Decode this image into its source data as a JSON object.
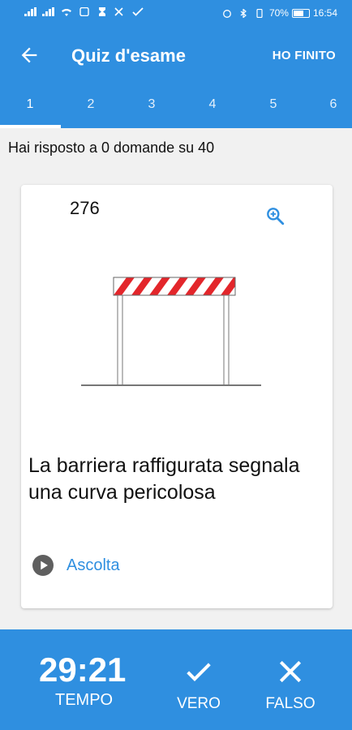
{
  "status_bar": {
    "battery": "70%",
    "time": "16:54"
  },
  "header": {
    "title": "Quiz d'esame",
    "done_label": "HO FINITO",
    "back_icon": "arrow-back-icon"
  },
  "tabs": [
    "1",
    "2",
    "3",
    "4",
    "5",
    "6"
  ],
  "selected_tab": "1",
  "progress_text": "Hai risposto a 0 domande su 40",
  "question": {
    "number": "276",
    "text": "La barriera raffigurata segnala una curva pericolosa",
    "listen_label": "Ascolta",
    "zoom_icon": "zoom-in-icon"
  },
  "footer": {
    "timer": "29:21",
    "timer_label": "TEMPO",
    "true_label": "VERO",
    "false_label": "FALSO"
  },
  "colors": {
    "primary": "#2f8fe0",
    "barrier_red": "#e3262b",
    "background": "#f1f1f1"
  }
}
